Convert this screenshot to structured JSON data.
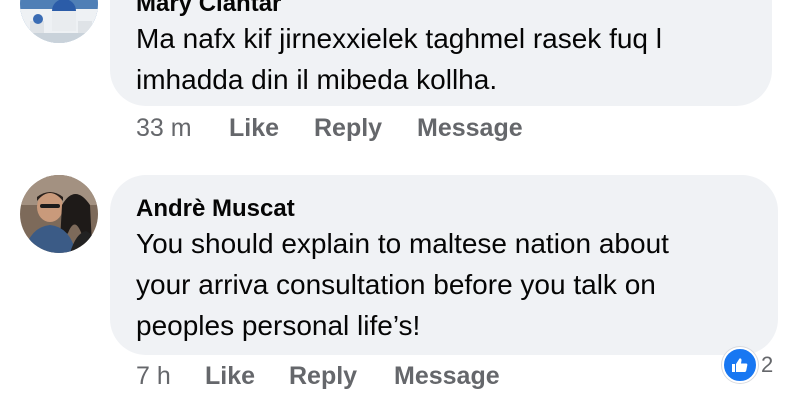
{
  "comments": [
    {
      "author": "Mary Ciantar",
      "text": "Ma nafx kif jirnexxielek taghmel rasek fuq l\nimhadda din il mibeda kollha.",
      "time": "33 m",
      "actions": {
        "like": "Like",
        "reply": "Reply",
        "message": "Message"
      }
    },
    {
      "author": "Andrè Muscat",
      "text": "You should explain to maltese nation about\nyour arriva consultation before you talk on\npeoples personal life’s!",
      "time": "7 h",
      "actions": {
        "like": "Like",
        "reply": "Reply",
        "message": "Message"
      },
      "reactions": {
        "icon": "thumbs-up-icon",
        "count": "2"
      }
    }
  ],
  "colors": {
    "bubble": "#f0f2f5",
    "secondary_text": "#65676b",
    "like_blue": "#1877f2"
  }
}
